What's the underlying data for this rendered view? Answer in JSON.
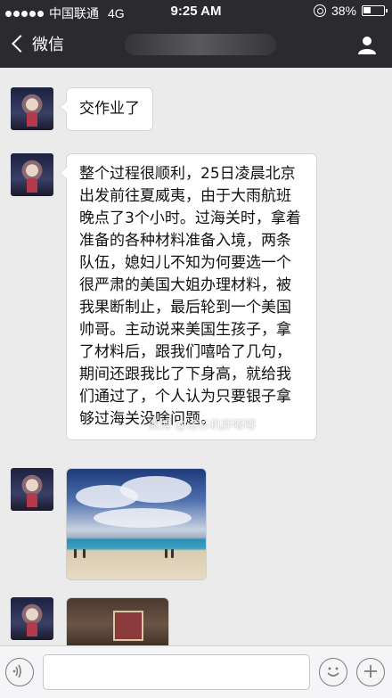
{
  "status_bar": {
    "carrier": "中国联通",
    "network": "4G",
    "time": "9:25 AM",
    "battery": "38%",
    "battery_level": 0.38
  },
  "nav": {
    "back_label": "微信"
  },
  "messages": [
    {
      "type": "text",
      "text": "交作业了"
    },
    {
      "type": "text",
      "text": "整个过程很顺利，25日凌晨北京出发前往夏威夷，由于大雨航班晚点了3个小时。过海关时，拿着准备的各种材料准备入境，两条队伍，媳妇儿不知为何要选一个很严肃的美国大姐办理材料，被我果断制止，最后轮到一个美国帅哥。主动说来美国生孩子，拿了材料后，跟我们嘻哈了几句，期间还跟我比了下身高，就给我们通过了，个人认为只要银子拿够过海关没啥问题。"
    },
    {
      "type": "image",
      "subject": "beach"
    },
    {
      "type": "image",
      "subject": "room"
    }
  ],
  "watermark": "微博 @洛杉机胖嘟嘟",
  "input": {
    "value": "",
    "placeholder": ""
  },
  "colors": {
    "bar_bg": "#2b2a2f",
    "chat_bg": "#ebebeb",
    "bubble_bg": "#ffffff"
  }
}
